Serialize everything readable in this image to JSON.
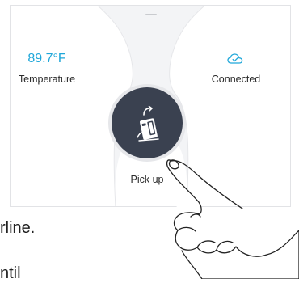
{
  "device": {
    "temperature": {
      "value": "89.7°F",
      "label": "Temperature",
      "value_color": "#1fa7d9"
    },
    "connection": {
      "icon": "cloud-check-icon",
      "label": "Connected",
      "icon_color": "#1fa7d9"
    },
    "action": {
      "icon": "pick-up-robot-icon",
      "label": "Pick up",
      "button_color": "#3a4150"
    }
  },
  "background_text": {
    "line1": "rline.",
    "line2": "ntil"
  }
}
